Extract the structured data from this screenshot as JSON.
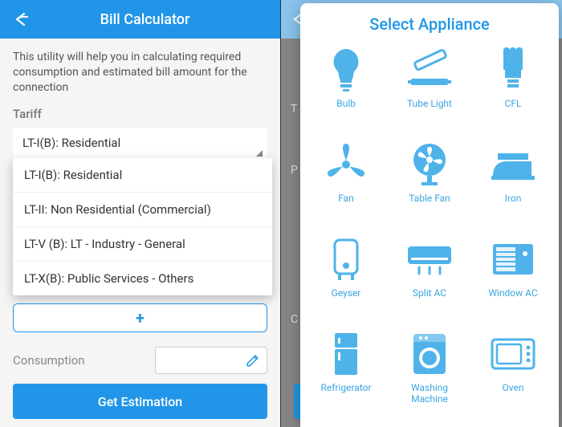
{
  "left": {
    "header_title": "Bill Calculator",
    "intro": "This utility will help you in calculating required consumption and estimated bill amount for the connection",
    "tariff_label": "Tariff",
    "selected_tariff": "LT-I(B): Residential",
    "tariff_options": [
      "LT-I(B): Residential",
      "LT-II: Non Residential (Commercial)",
      "LT-V (B): LT - Industry - General",
      "LT-X(B): Public Services - Others"
    ],
    "peeked_label": "P",
    "add_label": "+",
    "consumption_label": "Consumption",
    "estimate_label": "Get Estimation"
  },
  "right": {
    "modal_title": "Select Appliance",
    "dim_labels": [
      "T",
      "P",
      "C"
    ],
    "appliances": [
      {
        "id": "bulb",
        "label": "Bulb"
      },
      {
        "id": "tube-light",
        "label": "Tube Light"
      },
      {
        "id": "cfl",
        "label": "CFL"
      },
      {
        "id": "fan",
        "label": "Fan"
      },
      {
        "id": "table-fan",
        "label": "Table Fan"
      },
      {
        "id": "iron",
        "label": "Iron"
      },
      {
        "id": "geyser",
        "label": "Geyser"
      },
      {
        "id": "split-ac",
        "label": "Split AC"
      },
      {
        "id": "window-ac",
        "label": "Window AC"
      },
      {
        "id": "refrigerator",
        "label": "Refrigerator"
      },
      {
        "id": "washing-machine",
        "label": "Washing Machine"
      },
      {
        "id": "oven",
        "label": "Oven"
      }
    ]
  },
  "colors": {
    "primary": "#2196e8",
    "icon": "#4fb3ea"
  }
}
